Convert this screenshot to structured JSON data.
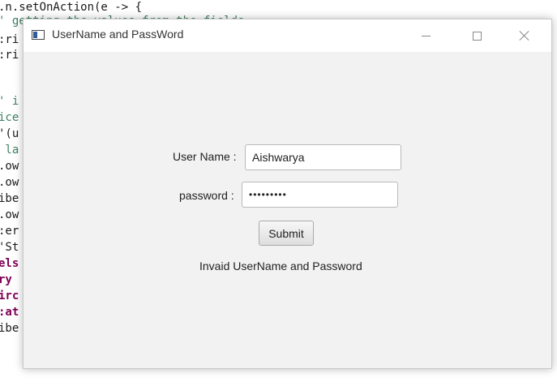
{
  "editor": {
    "lines": [
      {
        "text": ".n.setOnAction(e -> {",
        "style": "normal"
      },
      {
        "text": "' getting the values from the fields",
        "style": "comment"
      },
      {
        "text": ":ri",
        "style": "normal"
      },
      {
        "text": ":ri",
        "style": "normal"
      },
      {
        "text": "",
        "style": "normal"
      },
      {
        "text": "",
        "style": "normal"
      },
      {
        "text": "' i",
        "style": "comment"
      },
      {
        "text": "ice",
        "style": "comment"
      },
      {
        "text": "'(u",
        "style": "normal"
      },
      {
        "text": " la",
        "style": "comment"
      },
      {
        "text": ".ow",
        "style": "normal"
      },
      {
        "text": ".ow",
        "style": "normal"
      },
      {
        "text": "ibe",
        "style": "normal"
      },
      {
        "text": ".ow",
        "style": "normal"
      },
      {
        "text": ":er",
        "style": "normal"
      },
      {
        "text": "'St",
        "style": "normal"
      },
      {
        "text": "els",
        "style": "keyword"
      },
      {
        "text": "ry",
        "style": "keyword"
      },
      {
        "text": "irc",
        "style": "keyword"
      },
      {
        "text": ":at",
        "style": "keyword"
      },
      {
        "text": "ibe",
        "style": "normal"
      }
    ]
  },
  "window": {
    "title": "UserName and PassWord",
    "controls": {
      "minimize": "minimize",
      "maximize": "maximize",
      "close": "close"
    }
  },
  "form": {
    "username_label": "User Name :",
    "username_value": "Aishwarya",
    "password_label": "password :",
    "password_value": "•••••••••",
    "submit_label": "Submit",
    "status_message": "Invaid UserName and Password"
  }
}
